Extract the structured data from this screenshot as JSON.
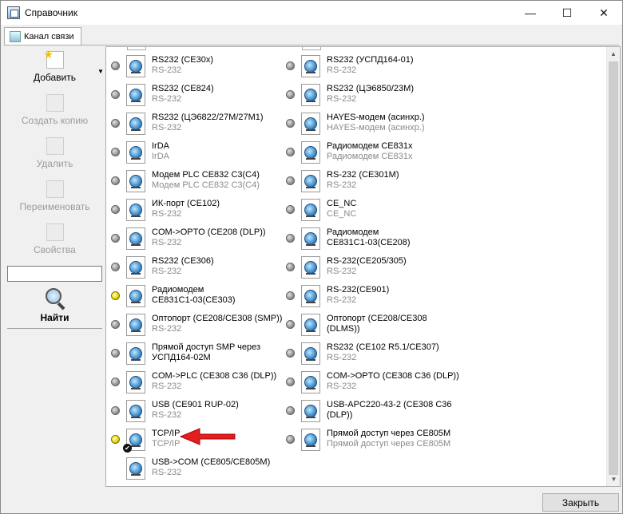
{
  "window": {
    "title": "Справочник",
    "minimize": "—",
    "maximize": "☐",
    "close": "✕"
  },
  "tab": {
    "label": "Канал связи"
  },
  "toolbar": {
    "add": "Добавить",
    "copy": "Создать копию",
    "delete": "Удалить",
    "rename": "Переименовать",
    "properties": "Свойства",
    "search_value": "",
    "find": "Найти"
  },
  "list": {
    "left": [
      {
        "name": "RS232 (CE30x)",
        "sub": "RS-232",
        "status": "gray"
      },
      {
        "name": "RS232 (CE824)",
        "sub": "RS-232",
        "status": "gray"
      },
      {
        "name": "RS232 (ЦЭ6822/27М/27М1)",
        "sub": "RS-232",
        "status": "gray"
      },
      {
        "name": "IrDA",
        "sub": "IrDA",
        "status": "gray"
      },
      {
        "name": "Модем PLC CE832 C3(C4)",
        "sub": "Модем PLC CE832 C3(C4)",
        "status": "gray"
      },
      {
        "name": "ИК-порт (CE102)",
        "sub": "RS-232",
        "status": "gray"
      },
      {
        "name": "COM->OPTO (CE208 (DLP))",
        "sub": "RS-232",
        "status": "gray"
      },
      {
        "name": "RS232 (CE306)",
        "sub": "RS-232",
        "status": "gray"
      },
      {
        "name": "Радиомодем",
        "sub": "CE831C1-03(CE303)",
        "status": "yellow",
        "sub_black": true
      },
      {
        "name": "Оптопорт (CE208/CE308 (SMP))",
        "sub": "RS-232",
        "status": "gray"
      },
      {
        "name": "Прямой доступ SMP через",
        "sub": "УСПД164-02М",
        "status": "gray",
        "sub_black": true
      },
      {
        "name": "COM->PLC (CE308 C36 (DLP))",
        "sub": "RS-232",
        "status": "gray"
      },
      {
        "name": "USB (CE901 RUP-02)",
        "sub": "RS-232",
        "status": "gray"
      },
      {
        "name": "TCP/IP",
        "sub": "TCP/IP",
        "status": "yellow",
        "checked": true
      },
      {
        "name": "USB->COM (CE805/CE805M)",
        "sub": "RS-232",
        "status": "none"
      }
    ],
    "right": [
      {
        "name": "RS232 (УСПД164-01)",
        "sub": "RS-232",
        "status": "gray"
      },
      {
        "name": "RS232 (ЦЭ6850/23М)",
        "sub": "RS-232",
        "status": "gray"
      },
      {
        "name": "HAYES-модем (асинхр.)",
        "sub": "HAYES-модем (асинхр.)",
        "status": "gray"
      },
      {
        "name": "Радиомодем CE831x",
        "sub": "Радиомодем CE831x",
        "status": "gray"
      },
      {
        "name": "RS-232 (CE301M)",
        "sub": "RS-232",
        "status": "gray"
      },
      {
        "name": "CE_NC",
        "sub": "CE_NC",
        "status": "gray"
      },
      {
        "name": "Радиомодем",
        "sub": "CE831C1-03(CE208)",
        "status": "gray",
        "sub_black": true
      },
      {
        "name": "RS-232(CE205/305)",
        "sub": "RS-232",
        "status": "gray"
      },
      {
        "name": "RS-232(CE901)",
        "sub": "RS-232",
        "status": "gray"
      },
      {
        "name": "Оптопорт (CE208/CE308",
        "sub": "(DLMS))",
        "status": "gray",
        "sub_black": true
      },
      {
        "name": "RS232 (CE102 R5.1/CE307)",
        "sub": "RS-232",
        "status": "gray"
      },
      {
        "name": "COM->OPTO (CE308 C36 (DLP))",
        "sub": "RS-232",
        "status": "gray"
      },
      {
        "name": "USB-APC220-43-2 (CE308 C36",
        "sub": "(DLP))",
        "status": "gray",
        "sub_black": true
      },
      {
        "name": "Прямой доступ через CE805M",
        "sub": "Прямой доступ через CE805M",
        "status": "gray"
      }
    ]
  },
  "footer": {
    "close_button": "Закрыть"
  }
}
